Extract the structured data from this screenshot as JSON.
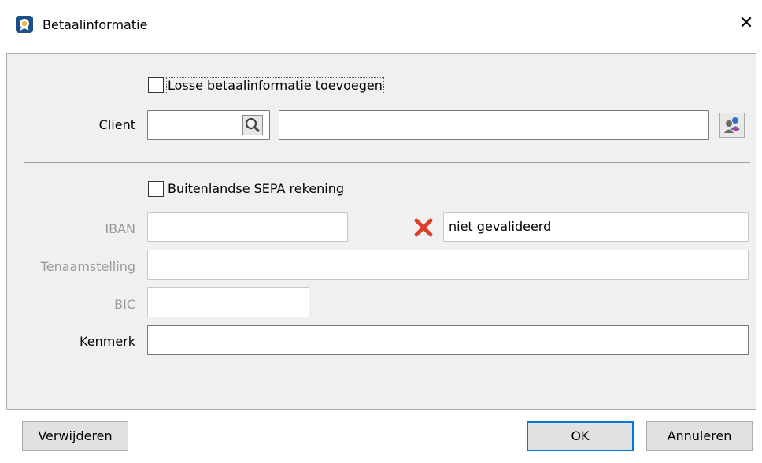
{
  "window": {
    "title": "Betaalinformatie"
  },
  "loose_payment": {
    "label": "Losse betaalinformatie toevoegen",
    "checked": false
  },
  "client": {
    "label": "Client",
    "code_value": "",
    "name_value": ""
  },
  "foreign_sepa": {
    "label": "Buitenlandse SEPA rekening",
    "checked": false
  },
  "iban": {
    "label": "IBAN",
    "value": "",
    "validation_text": "niet gevalideerd"
  },
  "tenaamstelling": {
    "label": "Tenaamstelling",
    "value": ""
  },
  "bic": {
    "label": "BIC",
    "value": ""
  },
  "kenmerk": {
    "label": "Kenmerk",
    "value": ""
  },
  "buttons": {
    "delete": "Verwijderen",
    "ok": "OK",
    "cancel": "Annuleren"
  },
  "colors": {
    "accent": "#0078d7",
    "error": "#d9412b",
    "panel": "#f0f0f0"
  },
  "icons": {
    "app": "app-icon",
    "close": "close-icon",
    "search": "search-icon",
    "people": "people-icon",
    "invalid": "invalid-x-icon"
  }
}
